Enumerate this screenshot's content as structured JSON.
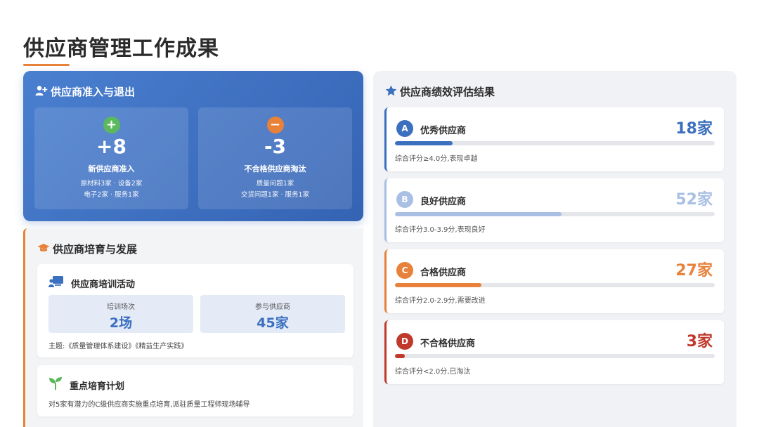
{
  "page": {
    "title": "供应商管理工作成果"
  },
  "entry": {
    "heading": "供应商准入与退出",
    "new": {
      "symbol": "+",
      "value": "+8",
      "name": "新供应商准入",
      "detail1": "原材料3家 · 设备2家",
      "detail2": "电子2家 · 服务1家",
      "color": "#5cb85c"
    },
    "removed": {
      "symbol": "−",
      "value": "-3",
      "name": "不合格供应商淘汰",
      "detail1": "质量问题1家",
      "detail2": "交货问题1家 · 服务1家",
      "color": "#e8813a"
    }
  },
  "develop": {
    "heading": "供应商培育与发展",
    "training": {
      "title": "供应商培训活动",
      "sessions_label": "培训场次",
      "sessions_value": "2场",
      "participants_label": "参与供应商",
      "participants_value": "45家",
      "topics": "主题:《质量管理体系建设》《精益生产实践》"
    },
    "plan": {
      "title": "重点培育计划",
      "description": "对5家有潜力的C级供应商实施重点培育,派驻质量工程师现场辅导"
    }
  },
  "performance": {
    "heading": "供应商绩效评估结果",
    "grades": [
      {
        "badge": "A",
        "name": "优秀供应商",
        "count": "18家",
        "desc": "综合评分≥4.0分,表现卓越",
        "color": "#3b6fbf",
        "fraction": 0.18
      },
      {
        "badge": "B",
        "name": "良好供应商",
        "count": "52家",
        "desc": "综合评分3.0-3.9分,表现良好",
        "color": "#a9bfe3",
        "fraction": 0.52
      },
      {
        "badge": "C",
        "name": "合格供应商",
        "count": "27家",
        "desc": "综合评分2.0-2.9分,需要改进",
        "color": "#e8813a",
        "fraction": 0.27
      },
      {
        "badge": "D",
        "name": "不合格供应商",
        "count": "3家",
        "desc": "综合评分<2.0分,已淘汰",
        "color": "#c0392b",
        "fraction": 0.03
      }
    ]
  },
  "icons": {
    "entry": "user-plus-icon",
    "develop": "graduation-cap-icon",
    "training": "presentation-icon",
    "plan": "sprout-icon",
    "performance": "star-icon"
  }
}
